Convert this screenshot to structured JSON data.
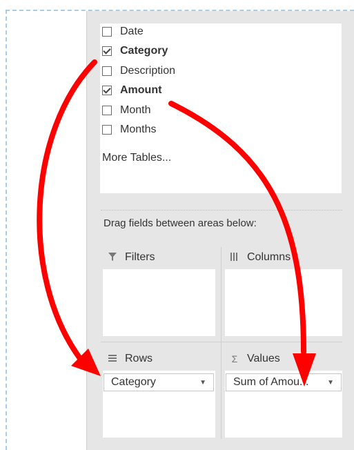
{
  "field_list": {
    "fields": [
      {
        "label": "Date",
        "checked": false
      },
      {
        "label": "Category",
        "checked": true
      },
      {
        "label": "Description",
        "checked": false
      },
      {
        "label": "Amount",
        "checked": true
      },
      {
        "label": "Month",
        "checked": false
      },
      {
        "label": "Months",
        "checked": false
      }
    ],
    "more_tables": "More Tables..."
  },
  "drag_hint": "Drag fields between areas below:",
  "areas": {
    "filters": {
      "label": "Filters",
      "icon": "filter-icon"
    },
    "columns": {
      "label": "Columns",
      "icon": "columns-icon"
    },
    "rows": {
      "label": "Rows",
      "icon": "rows-icon",
      "item": "Category"
    },
    "values": {
      "label": "Values",
      "icon": "sigma-icon",
      "item": "Sum of Amou..."
    }
  },
  "colors": {
    "arrow": "#ff0000",
    "pane": "#e6e6e6",
    "dashed_border": "#a8cdea"
  }
}
